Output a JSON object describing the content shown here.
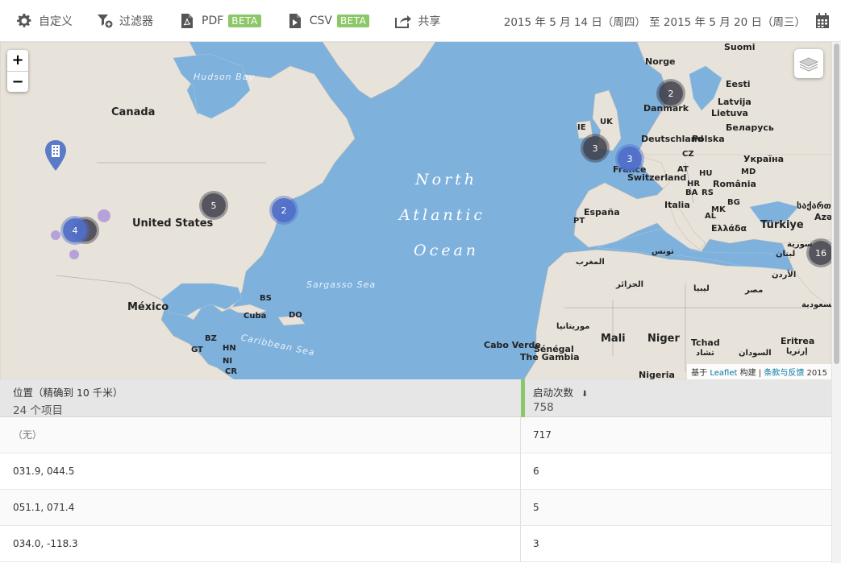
{
  "toolbar": {
    "customize": "自定义",
    "filter": "过滤器",
    "pdf": "PDF",
    "pdf_badge": "BETA",
    "csv": "CSV",
    "csv_badge": "BETA",
    "share": "共享",
    "date_range": "2015 年 5 月 14 日（周四） 至 2015 年 5 月 20 日（周三）"
  },
  "map": {
    "zoom_in": "+",
    "zoom_out": "−",
    "labels": {
      "hudson_bay": "Hudson Bay",
      "canada": "Canada",
      "united_states": "United States",
      "mexico": "México",
      "north": "North",
      "atlantic": "Atlantic",
      "ocean": "Ocean",
      "sargasso": "Sargasso Sea",
      "caribbean": "Caribbean Sea",
      "cuba": "Cuba",
      "bs": "BS",
      "do": "DO",
      "bz": "BZ",
      "gt": "GT",
      "hn": "HN",
      "ni": "NI",
      "cr": "CR",
      "norge": "Norge",
      "suomi": "Suomi",
      "eesti": "Eesti",
      "latvija": "Latvija",
      "lietuva": "Lietuva",
      "danmark": "Danmark",
      "belarus": "Беларусь",
      "ie": "IE",
      "uk": "UK",
      "deutschland": "Deutschland",
      "polska": "Polska",
      "cz": "CZ",
      "ukraina": "Україна",
      "france": "France",
      "at": "AT",
      "hu": "HU",
      "md": "MD",
      "switzerland": "Switzerland",
      "hr": "HR",
      "romania": "România",
      "ba": "BA",
      "rs": "RS",
      "bg": "BG",
      "italia": "Italia",
      "mk": "MK",
      "al": "AL",
      "ellada": "Ελλάδα",
      "turkiye": "Türkiye",
      "espana": "España",
      "pt": "PT",
      "morocco": "المغرب",
      "tunisia": "تونس",
      "algeria": "الجزائر",
      "libya": "ليبيا",
      "egypt": "مصر",
      "mauritania": "موريتانيا",
      "mali": "Mali",
      "niger": "Niger",
      "tchad": "Tchad",
      "chad_ar": "تشاد",
      "sudan": "السودان",
      "eritrea": "Eritrea",
      "eritrea_ar": "إرتريا",
      "cabo_verde": "Cabo Verde",
      "senegal": "Sénégal",
      "gambia": "The Gambia",
      "nigeria": "Nigeria",
      "syria": "سورية",
      "jordan": "الأردن",
      "lebanon": "لبنان",
      "saudi": "السعودية",
      "georgia": "საქართველო",
      "aze": "Azə"
    },
    "clusters": {
      "dk": "2",
      "uk": "3",
      "fr": "3",
      "us_mid": "5",
      "us_east": "2",
      "us_west": "4",
      "me": "16"
    },
    "attribution": {
      "prefix": "基于",
      "leaflet": "Leaflet",
      "built": "构建 |",
      "terms": "条款与反馈",
      "year": "2015"
    }
  },
  "table": {
    "col_location": "位置（精确到 10 千米）",
    "col_location_sub": "24 个项目",
    "col_launches": "启动次数",
    "col_launches_sub": "758",
    "sort_icon": "⬇",
    "rows": [
      {
        "location": "（无）",
        "count": "717"
      },
      {
        "location": "031.9, 044.5",
        "count": "6"
      },
      {
        "location": "051.1, 071.4",
        "count": "5"
      },
      {
        "location": "034.0, -118.3",
        "count": "3"
      }
    ]
  },
  "colors": {
    "accent_green": "#8cc768",
    "ocean": "#7eb1dc",
    "land": "#e8e3da",
    "cluster_blue": "#506ec8",
    "cluster_dark": "#3c3c46"
  }
}
